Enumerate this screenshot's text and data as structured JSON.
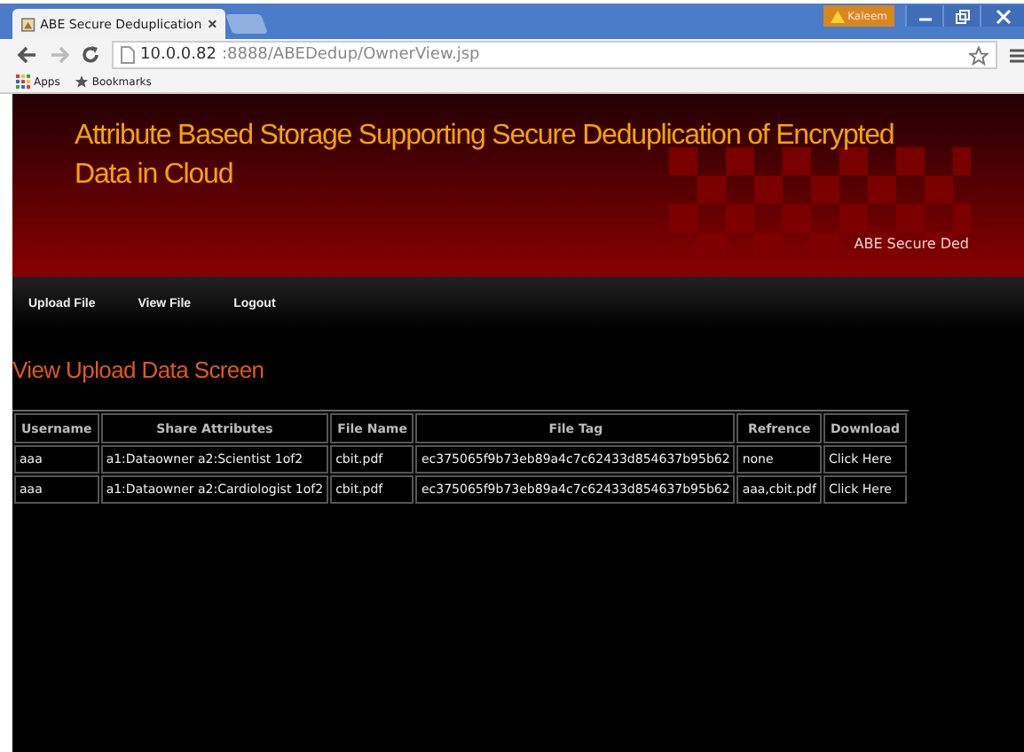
{
  "browser": {
    "tab_title": "ABE Secure Deduplication",
    "warning_label": "Kaleem",
    "url_host": "10.0.0.82",
    "url_rest": ":8888/ABEDedup/OwnerView.jsp",
    "bookmarks": [
      "Apps",
      "Bookmarks"
    ]
  },
  "header": {
    "title": "Attribute Based Storage Supporting Secure Deduplication of Encrypted Data in Cloud",
    "subtitle": "ABE Secure Ded"
  },
  "nav": [
    "Upload File",
    "View File",
    "Logout"
  ],
  "heading": "View Upload Data Screen",
  "table": {
    "columns": [
      "Username",
      "Share Attributes",
      "File Name",
      "File Tag",
      "Refrence",
      "Download"
    ],
    "rows": [
      {
        "cells": [
          "aaa",
          "a1:Dataowner a2:Scientist 1of2",
          "cbit.pdf",
          "ec375065f9b73eb89a4c7c62433d854637b95b62",
          "none",
          "Click Here"
        ]
      },
      {
        "cells": [
          "aaa",
          "a1:Dataowner a2:Cardiologist 1of2",
          "cbit.pdf",
          "ec375065f9b73eb89a4c7c62433d854637b95b62",
          "aaa,cbit.pdf",
          "Click Here"
        ]
      }
    ]
  }
}
